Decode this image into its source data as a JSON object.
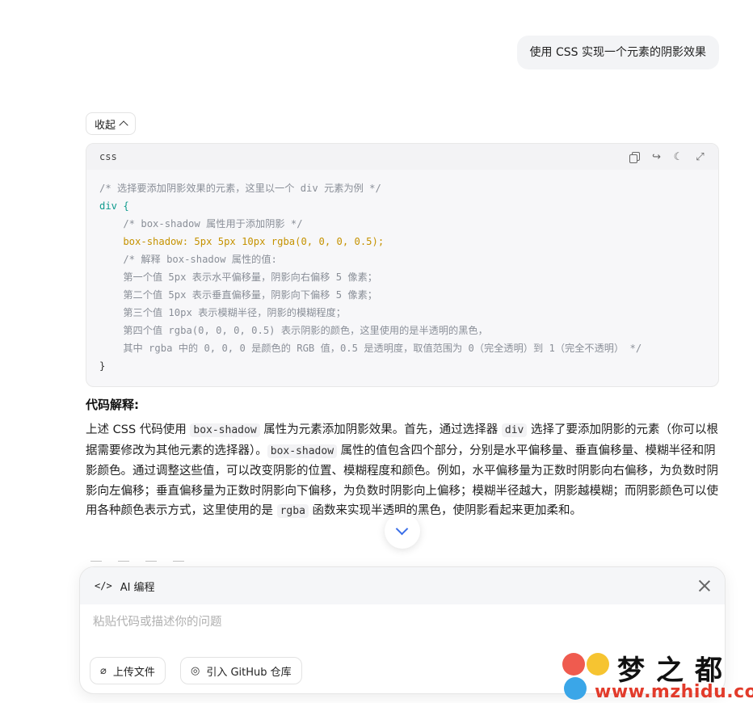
{
  "user_message": "使用 CSS 实现一个元素的阴影效果",
  "collapse_label": "收起",
  "code_block": {
    "language": "css",
    "lines": [
      "/* 选择要添加阴影效果的元素，这里以一个 div 元素为例 */",
      "div {",
      "    /* box-shadow 属性用于添加阴影 */",
      "    box-shadow: 5px 5px 10px rgba(0, 0, 0, 0.5);",
      "    /* 解释 box-shadow 属性的值:",
      "    第一个值 5px 表示水平偏移量，阴影向右偏移 5 像素；",
      "    第二个值 5px 表示垂直偏移量，阴影向下偏移 5 像素；",
      "    第三个值 10px 表示模糊半径，阴影的模糊程度；",
      "    第四个值 rgba(0, 0, 0, 0.5) 表示阴影的颜色，这里使用的是半透明的黑色，",
      "    其中 rgba 中的 0, 0, 0 是颜色的 RGB 值，0.5 是透明度，取值范围为 0（完全透明）到 1（完全不透明） */",
      "}"
    ]
  },
  "explanation": {
    "title": "代码解释",
    "title_colon": ":",
    "t1": "上述 CSS 代码使用 ",
    "c1": "box-shadow",
    "t2": " 属性为元素添加阴影效果。首先，通过选择器 ",
    "c2": "div",
    "t3": " 选择了要添加阴影的元素（你可以根据需要修改为其他元素的选择器）。",
    "c3": "box-shadow",
    "t4": " 属性的值包含四个部分，分别是水平偏移量、垂直偏移量、模糊半径和阴影颜色。通过调整这些值，可以改变阴影的位置、模糊程度和颜色。例如，水平偏移量为正数时阴影向右偏移，为负数时阴影向左偏移；垂直偏移量为正数时阴影向下偏移，为负数时阴影向上偏移；模糊半径越大，阴影越模糊；而阴影颜色可以使用各种颜色表示方式，这里使用的是 ",
    "c4": "rgba",
    "t5": " 函数来实现半透明的黑色，使阴影看起来更加柔和。"
  },
  "composer": {
    "mode_icon": "</>",
    "mode_label": "AI 编程",
    "placeholder": "粘贴代码或描述你的问题",
    "upload_label": "上传文件",
    "github_label": "引入 GitHub 仓库"
  },
  "watermark": {
    "title": "梦之都",
    "url": "www.mzhidu.com"
  },
  "icons": {
    "copy": "copy-icon",
    "share": "share-icon",
    "theme": "moon-icon",
    "expand": "expand-icon",
    "close": "close-icon",
    "paperclip": "paperclip-icon",
    "github": "github-icon",
    "scroll": "chevron-down-icon"
  }
}
